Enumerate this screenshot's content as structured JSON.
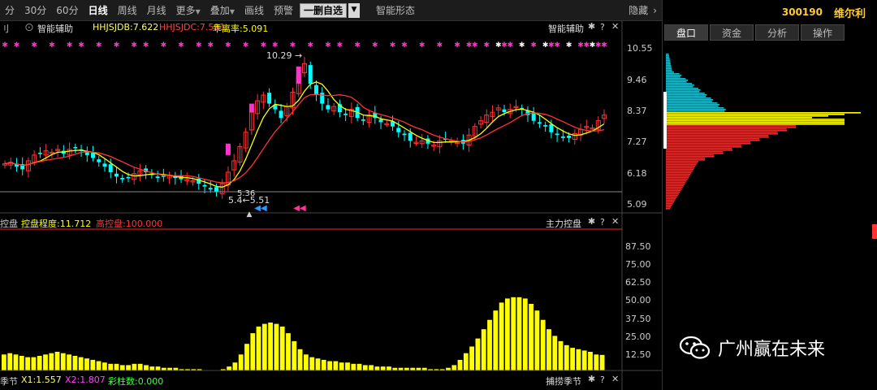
{
  "toolbar": {
    "items": [
      "分",
      "30分",
      "60分",
      "日线",
      "周线",
      "月线",
      "更多",
      "叠加",
      "画线",
      "预警"
    ],
    "active_index": 3,
    "delete_self_select": "一删自选",
    "smart_form": "智能形态",
    "hide": "隐藏"
  },
  "main_panel": {
    "name": "智能辅助",
    "indicators": [
      {
        "label": "HHJSJDB:7.622",
        "color": "#ffff66"
      },
      {
        "label": "HHJSJDC:7.591",
        "color": "#ff4444"
      },
      {
        "label": "乖离率:5.091",
        "color": "#ffff00"
      }
    ],
    "right_title": "智能辅助",
    "price_ticks": [
      "10.55",
      "9.46",
      "8.37",
      "7.27",
      "6.18",
      "5.09"
    ],
    "high_annotation": "10.29",
    "low_annotation": "5.51",
    "low_annotation2": "5.36",
    "low_annotation3": "5.4"
  },
  "sub_panel1": {
    "name": "控盘",
    "indicators": [
      {
        "label": "控盘程度:11.712",
        "color": "#ffff00"
      },
      {
        "label": "高控盘:100.000",
        "color": "#ff3333"
      }
    ],
    "right_title": "主力控盘",
    "ticks": [
      "87.50",
      "75.00",
      "62.50",
      "50.00",
      "37.50",
      "25.00",
      "12.50"
    ]
  },
  "sub_panel2": {
    "name": "季节",
    "indicators": [
      {
        "label": "X1:1.557",
        "color": "#ffff66"
      },
      {
        "label": "X2:1.807",
        "color": "#ff44ff"
      },
      {
        "label": "彩柱数:0.000",
        "color": "#44ff44"
      }
    ],
    "right_title": "捕捞季节"
  },
  "right_panel": {
    "code": "300190",
    "name": "维尔利",
    "tabs": [
      "盘口",
      "资金",
      "分析",
      "操作"
    ],
    "active_tab": 0
  },
  "watermark": {
    "text": "广州赢在未来",
    "icon": "wechat-icon"
  },
  "icons": {
    "gear": "gear-icon",
    "help": "help-icon",
    "close": "close-icon"
  },
  "colors": {
    "up": "#ff3333",
    "down": "#00ffff",
    "ma_short": "#ffff00",
    "ma_long": "#ff3333",
    "bars": "#ffff00",
    "magenta": "#ff33cc"
  },
  "chart_data": [
    {
      "type": "candlestick",
      "ylim": [
        5.09,
        10.55
      ],
      "yticks": [
        10.55,
        9.46,
        8.37,
        7.27,
        6.18,
        5.09
      ],
      "close": [
        6.5,
        6.55,
        6.4,
        6.3,
        6.6,
        6.8,
        6.85,
        6.95,
        6.9,
        7.0,
        6.85,
        7.0,
        7.05,
        6.95,
        6.8,
        6.7,
        6.55,
        6.4,
        6.2,
        6.05,
        5.95,
        6.0,
        6.15,
        6.25,
        6.2,
        6.1,
        6.0,
        6.05,
        6.1,
        6.0,
        5.95,
        5.95,
        5.9,
        5.8,
        5.7,
        5.6,
        5.5,
        5.8,
        6.2,
        6.6,
        7.1,
        7.6,
        8.3,
        8.7,
        8.9,
        8.6,
        8.4,
        8.1,
        8.5,
        9.0,
        9.6,
        10.0,
        9.3,
        8.9,
        8.6,
        8.4,
        8.5,
        8.3,
        8.2,
        8.4,
        8.1,
        8.0,
        8.2,
        8.1,
        7.95,
        7.9,
        7.8,
        7.6,
        7.5,
        7.3,
        7.25,
        7.3,
        7.2,
        7.15,
        7.3,
        7.35,
        7.3,
        7.25,
        7.2,
        7.5,
        7.8,
        8.0,
        8.2,
        8.3,
        8.45,
        8.3,
        8.4,
        8.5,
        8.4,
        8.2,
        8.0,
        7.9,
        7.8,
        7.6,
        7.5,
        7.4,
        7.4,
        7.55,
        7.7,
        7.8,
        7.75,
        8.0,
        8.2
      ],
      "ma_short": "yellow",
      "ma_long": "red"
    },
    {
      "type": "bar",
      "ylim": [
        0,
        100
      ],
      "yticks": [
        87.5,
        75.0,
        62.5,
        50.0,
        37.5,
        25.0,
        12.5
      ],
      "values": [
        12,
        13,
        12,
        11,
        10,
        10,
        11,
        12,
        13,
        14,
        13,
        12,
        11,
        10,
        9,
        8,
        7,
        6,
        5,
        5,
        4,
        4,
        5,
        5,
        4,
        3,
        3,
        2,
        2,
        2,
        1,
        1,
        1,
        1,
        0,
        0,
        0,
        1,
        3,
        6,
        12,
        20,
        28,
        33,
        35,
        36,
        35,
        33,
        28,
        22,
        16,
        12,
        10,
        9,
        8,
        7,
        7,
        6,
        6,
        5,
        5,
        4,
        4,
        3,
        3,
        3,
        2,
        2,
        2,
        2,
        2,
        2,
        1,
        1,
        1,
        2,
        4,
        8,
        13,
        18,
        24,
        31,
        38,
        45,
        51,
        54,
        55,
        55,
        54,
        50,
        45,
        38,
        31,
        26,
        22,
        19,
        17,
        16,
        15,
        14,
        12,
        11.7
      ]
    }
  ]
}
